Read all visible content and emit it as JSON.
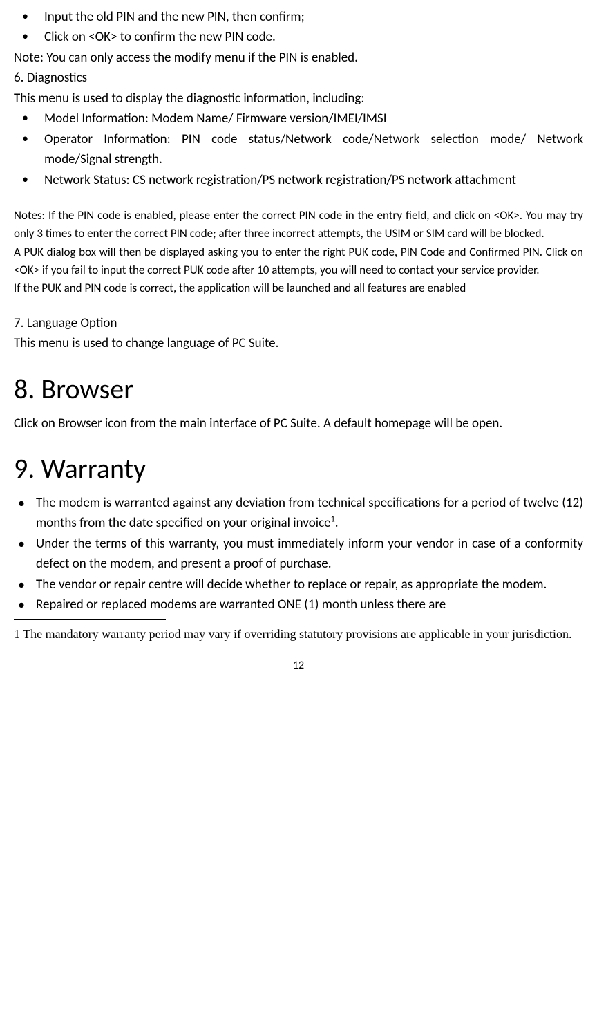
{
  "top_bullets": [
    "Input the old PIN and the new PIN, then confirm;",
    "Click on <OK> to confirm the new PIN code."
  ],
  "top_note": "Note: You can only access the modify menu if the PIN is enabled.",
  "sec6_heading": "6.   Diagnostics",
  "sec6_intro": "This menu is used to display the diagnostic information, including:",
  "sec6_bullets": [
    "Model Information: Modem Name/ Firmware version/IMEI/IMSI",
    "Operator Information: PIN code status/Network code/Network selection mode/ Network mode/Signal strength.",
    "Network Status: CS network registration/PS network registration/PS network attachment"
  ],
  "notes_p1": "Notes: If the PIN code is enabled, please enter the correct PIN code in the entry field, and click on <OK>. You may try only 3 times to enter the correct PIN code; after three incorrect attempts, the USIM or SIM card will be blocked.",
  "notes_p2": "A PUK dialog box will then be displayed asking you to enter the right PUK code, PIN Code and Confirmed PIN. Click on <OK> if you fail to input the correct PUK code after 10 attempts, you will need to contact your service provider.",
  "notes_p3": "If the PUK and PIN code is correct, the application will be launched and all features are enabled",
  "sec7_heading": "7.   Language Option",
  "sec7_text": "This menu is used to change language of PC Suite.",
  "sec8_heading": "8. Browser",
  "sec8_text": "Click on Browser icon from the main interface of PC Suite. A default homepage will be open.",
  "sec9_heading": "9. Warranty",
  "sec9_bullets_pre": "The modem is warranted against any deviation from technical specifications for a period of twelve (12) months from the date specified on your original invoice",
  "sec9_bullets_sup": "1",
  "sec9_bullets_post": ".",
  "sec9_bullets_rest": [
    "Under the terms of this warranty, you must immediately inform your vendor in case of a conformity defect on the modem, and present a proof of purchase.",
    "The vendor or repair centre will decide whether to replace or repair, as appropriate the modem.",
    "Repaired or replaced modems are warranted ONE (1) month unless there are"
  ],
  "footnote": "1  The mandatory warranty period may vary if overriding statutory provisions are applicable in your jurisdiction.",
  "page_number": "12"
}
